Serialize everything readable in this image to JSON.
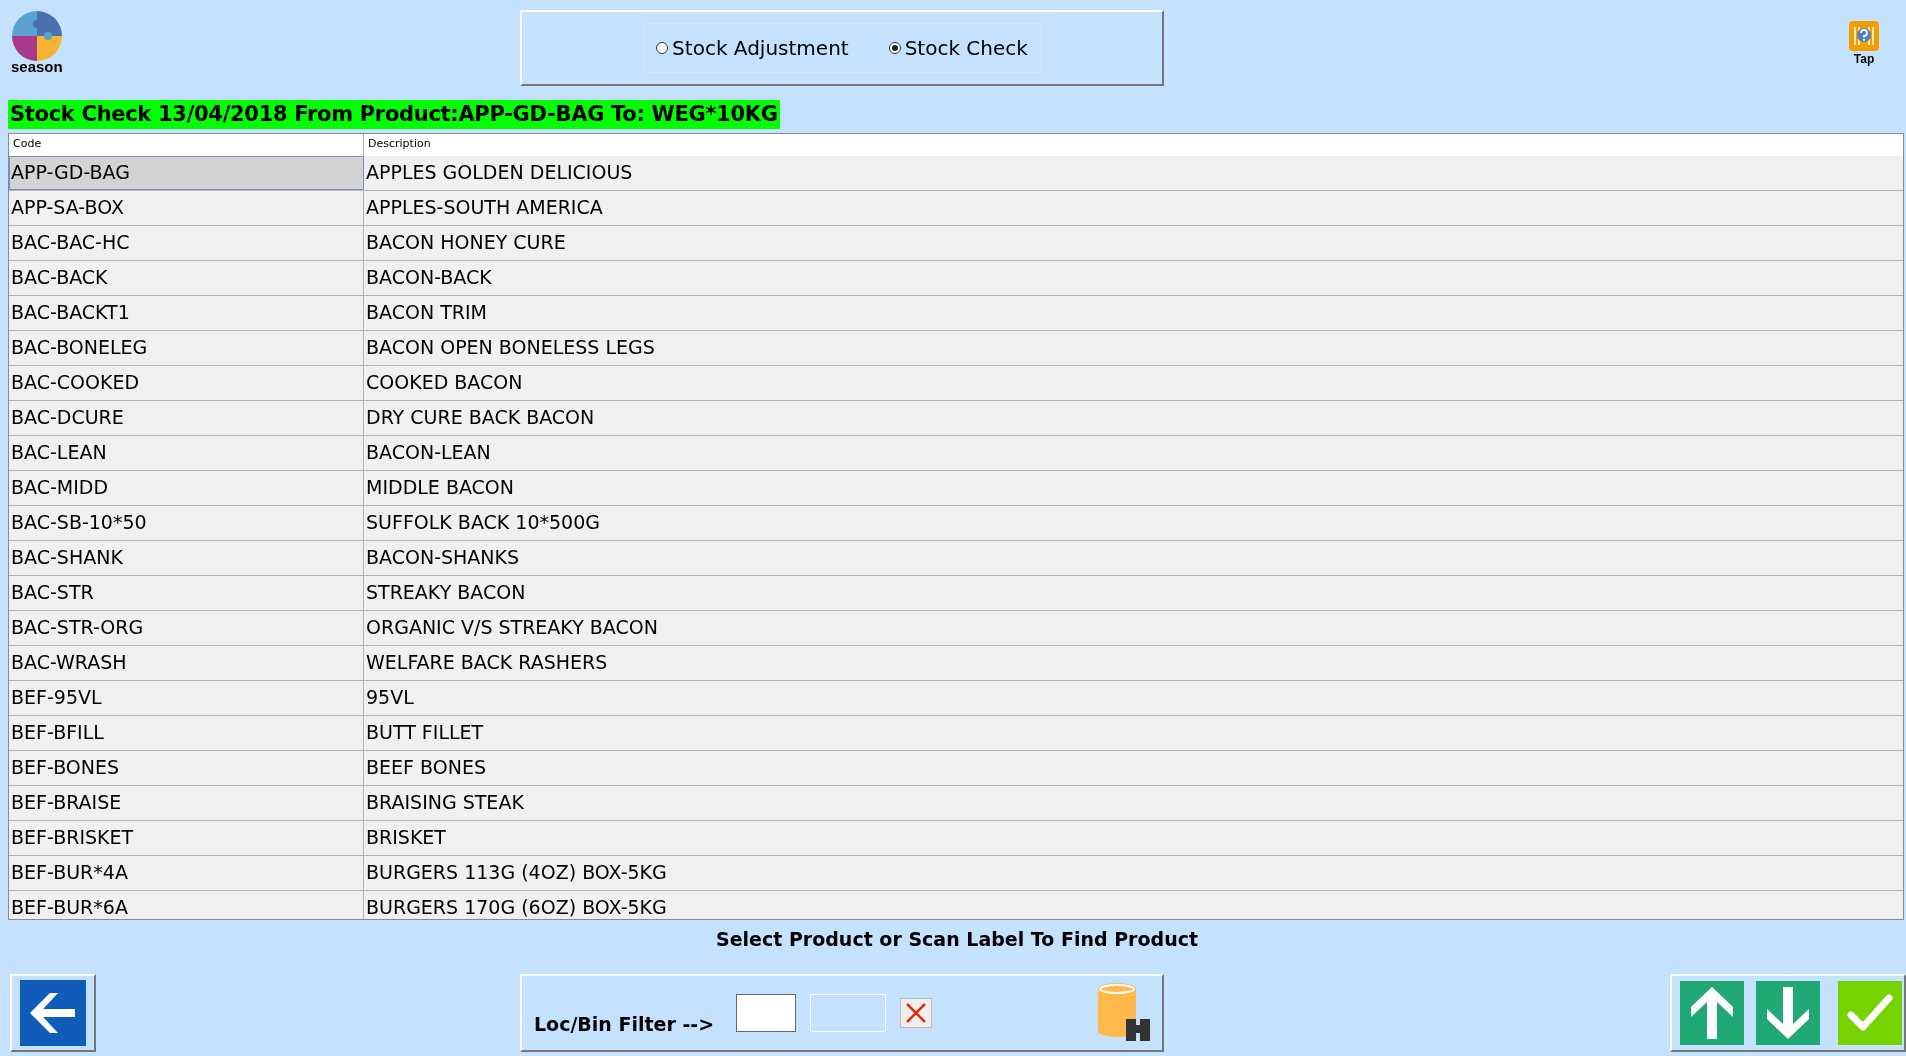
{
  "logo": {
    "text": "season"
  },
  "mode_options": [
    {
      "label": "Stock Adjustment",
      "selected": false
    },
    {
      "label": "Stock Check",
      "selected": true
    }
  ],
  "help": {
    "label": "Tap"
  },
  "title": "Stock Check 13/04/2018 From Product:APP-GD-BAG To: WEG*10KG",
  "table": {
    "columns": [
      "Code",
      "Description"
    ],
    "rows": [
      {
        "code": "APP-GD-BAG",
        "description": "APPLES GOLDEN DELICIOUS",
        "selected": true
      },
      {
        "code": "APP-SA-BOX",
        "description": "APPLES-SOUTH AMERICA",
        "selected": false
      },
      {
        "code": "BAC-BAC-HC",
        "description": "BACON HONEY CURE",
        "selected": false
      },
      {
        "code": "BAC-BACK",
        "description": "BACON-BACK",
        "selected": false
      },
      {
        "code": "BAC-BACKT1",
        "description": "BACON TRIM",
        "selected": false
      },
      {
        "code": "BAC-BONELEG",
        "description": "BACON OPEN BONELESS LEGS",
        "selected": false
      },
      {
        "code": "BAC-COOKED",
        "description": "COOKED BACON",
        "selected": false
      },
      {
        "code": "BAC-DCURE",
        "description": "DRY CURE BACK BACON",
        "selected": false
      },
      {
        "code": "BAC-LEAN",
        "description": "BACON-LEAN",
        "selected": false
      },
      {
        "code": "BAC-MIDD",
        "description": "MIDDLE BACON",
        "selected": false
      },
      {
        "code": "BAC-SB-10*50",
        "description": "SUFFOLK BACK 10*500G",
        "selected": false
      },
      {
        "code": "BAC-SHANK",
        "description": "BACON-SHANKS",
        "selected": false
      },
      {
        "code": "BAC-STR",
        "description": "STREAKY BACON",
        "selected": false
      },
      {
        "code": "BAC-STR-ORG",
        "description": "ORGANIC V/S STREAKY BACON",
        "selected": false
      },
      {
        "code": "BAC-WRASH",
        "description": "WELFARE BACK RASHERS",
        "selected": false
      },
      {
        "code": "BEF-95VL",
        "description": "95VL",
        "selected": false
      },
      {
        "code": "BEF-BFILL",
        "description": "BUTT FILLET",
        "selected": false
      },
      {
        "code": "BEF-BONES",
        "description": "BEEF BONES",
        "selected": false
      },
      {
        "code": "BEF-BRAISE",
        "description": "BRAISING STEAK",
        "selected": false
      },
      {
        "code": "BEF-BRISKET",
        "description": "BRISKET",
        "selected": false
      },
      {
        "code": "BEF-BUR*4A",
        "description": "BURGERS 113G (4OZ) BOX-5KG",
        "selected": false
      },
      {
        "code": "BEF-BUR*6A",
        "description": "BURGERS 170G (6OZ) BOX-5KG",
        "selected": false
      }
    ]
  },
  "status_text": "Select Product or Scan Label To Find Product",
  "filter": {
    "label": "Loc/Bin Filter -->"
  }
}
